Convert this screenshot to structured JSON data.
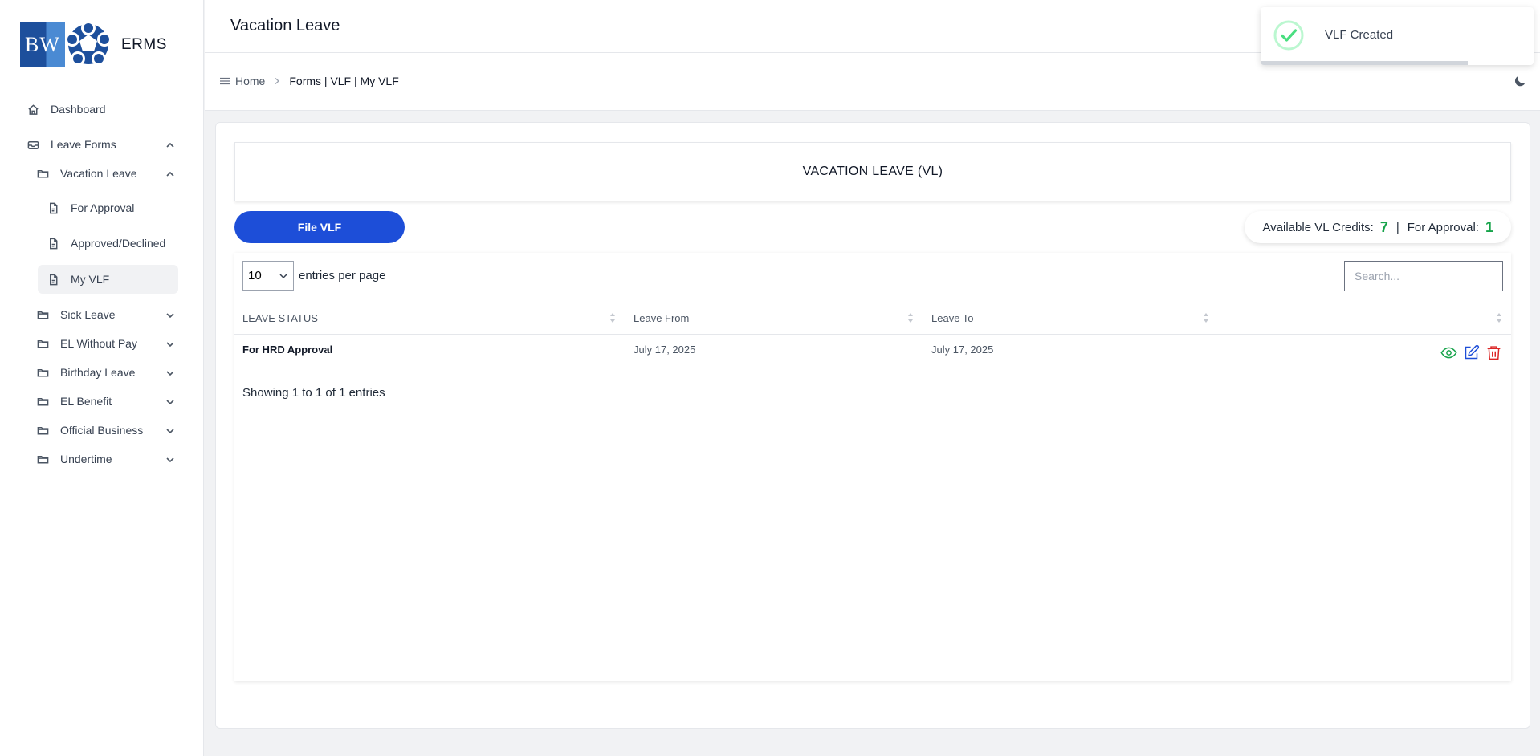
{
  "brand": {
    "logo_text": "BW",
    "name": "ERMS"
  },
  "sidebar": {
    "items": [
      {
        "label": "Dashboard"
      },
      {
        "label": "Leave Forms"
      },
      {
        "label": "Vacation Leave"
      },
      {
        "label": "For Approval"
      },
      {
        "label": "Approved/Declined"
      },
      {
        "label": "My VLF"
      },
      {
        "label": "Sick Leave"
      },
      {
        "label": "EL Without Pay"
      },
      {
        "label": "Birthday Leave"
      },
      {
        "label": "EL Benefit"
      },
      {
        "label": "Official Business"
      },
      {
        "label": "Undertime"
      }
    ]
  },
  "header": {
    "title": "Vacation Leave"
  },
  "breadcrumb": {
    "home": "Home",
    "current": "Forms | VLF | My VLF"
  },
  "section": {
    "title": "VACATION LEAVE (VL)"
  },
  "actions": {
    "file_button": "File VLF"
  },
  "credits": {
    "available_label": "Available VL Credits:",
    "available_value": "7",
    "separator": "|",
    "approval_label": "For Approval:",
    "approval_value": "1"
  },
  "table": {
    "per_page_value": "10",
    "per_page_label": "entries per page",
    "search_placeholder": "Search...",
    "columns": [
      "LEAVE STATUS",
      "Leave From",
      "Leave To"
    ],
    "rows": [
      {
        "status": "For HRD Approval",
        "from": "July 17, 2025",
        "to": "July 17, 2025"
      }
    ],
    "footer": "Showing 1 to 1 of 1 entries"
  },
  "toast": {
    "message": "VLF Created",
    "progress": 0.76
  },
  "colors": {
    "primary": "#1d4ed8",
    "success": "#16a34a",
    "danger": "#dc2626"
  },
  "icons": [
    "home-icon",
    "inbox-icon",
    "folder-icon",
    "file-icon",
    "chevron-up-icon",
    "chevron-down-icon",
    "menu-icon",
    "moon-icon",
    "eye-icon",
    "edit-icon",
    "trash-icon",
    "check-circle-icon"
  ]
}
